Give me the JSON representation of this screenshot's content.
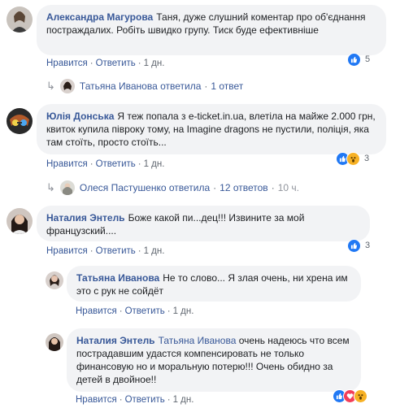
{
  "actions": {
    "like": "Нравится",
    "reply": "Ответить",
    "sep": "·"
  },
  "comments": [
    {
      "author": "Александра Магурова",
      "text": "Таня, дуже слушний коментар про об'єднання постраждалих. Робіть швидко групу. Тиск буде ефективніше",
      "time": "1 дн.",
      "reaction_count": "5",
      "reply_summary": {
        "name": "Татьяна Иванова ответила",
        "count": "1 ответ"
      }
    },
    {
      "author": "Юлія Донська",
      "text": "Я теж попала з e-ticket.in.ua, влетіла на майже 2.000 грн, квиток купила півроку тому, на Imagine dragons не пустили, поліція, яка там стоїть, просто стоїть...",
      "time": "1 дн.",
      "reaction_count": "3",
      "reply_summary": {
        "name": "Олеся Пастушенко ответила",
        "count": "12 ответов",
        "time": "10 ч."
      }
    },
    {
      "author": "Наталия Энтель",
      "text": "Боже какой пи...дец!!! Извините за мой французский....",
      "time": "1 дн.",
      "reaction_count": "3",
      "replies": [
        {
          "author": "Татьяна Иванова",
          "text": "Не то слово... Я злая очень, ни хрена им это с рук не сойдёт",
          "time": "1 дн."
        },
        {
          "author": "Наталия Энтель",
          "mention": "Татьяна Иванова",
          "text": "очень надеюсь что всем пострадавшим удастся компенсировать не только финансовую но и моральную потерю!!! Очень обидно за детей в двойное!!",
          "time": "1 дн."
        }
      ]
    }
  ],
  "colors": {
    "link": "#385898",
    "bubble": "#f2f3f5",
    "like": "#2078f4",
    "wow": "#f7b125",
    "love": "#f33e58"
  }
}
